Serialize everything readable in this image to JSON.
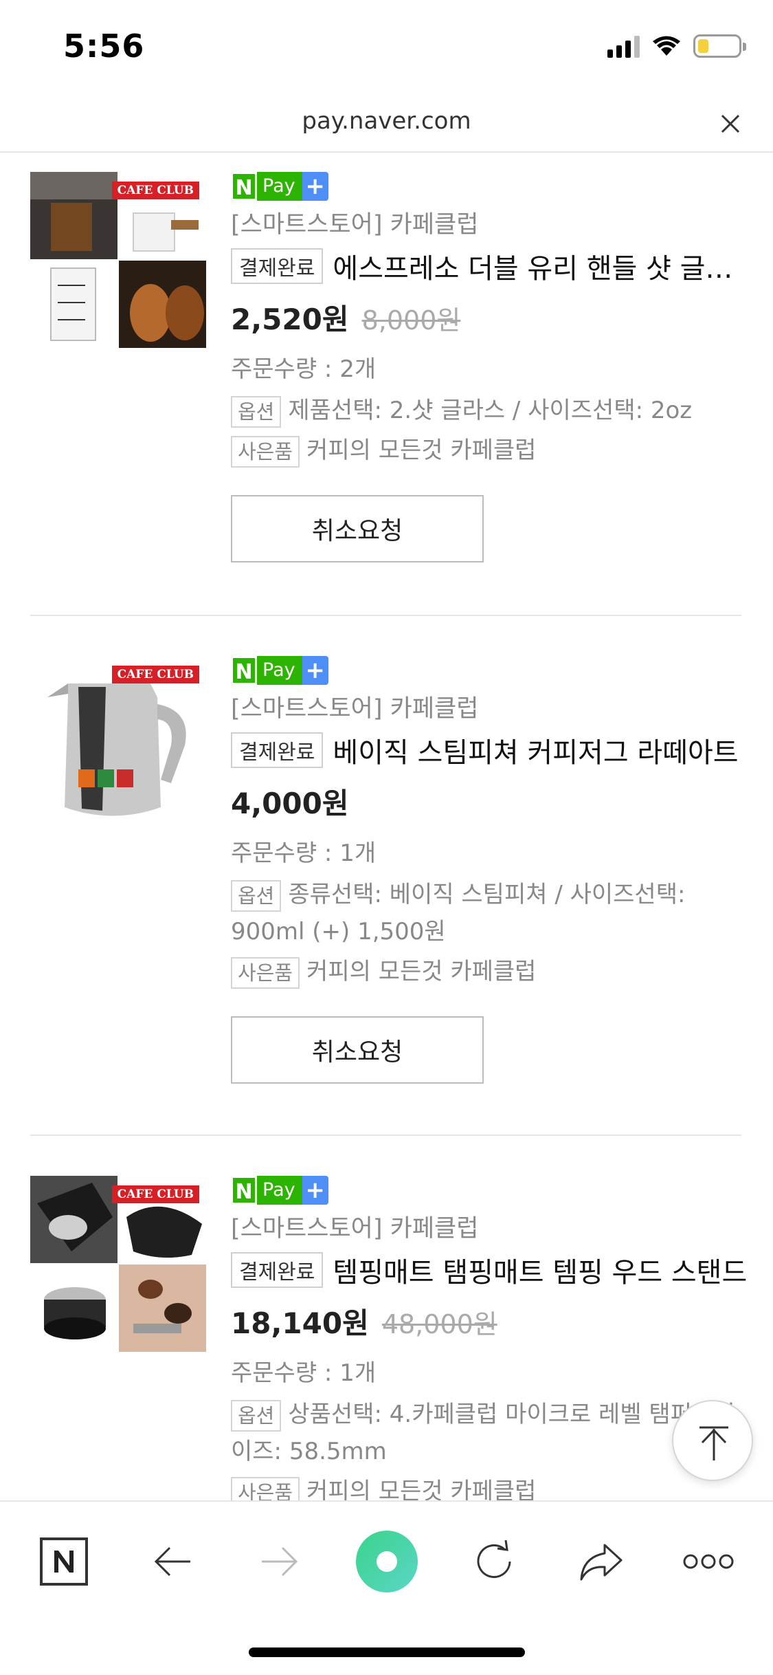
{
  "status": {
    "time": "5:56"
  },
  "browser": {
    "url": "pay.naver.com"
  },
  "npay_badge": {
    "n": "N",
    "pay": "Pay",
    "plus": "+"
  },
  "orders": [
    {
      "brand_badge": "CAFE CLUB",
      "seller": "[스마트스토어] 카페클럽",
      "status": "결제완료",
      "title": "에스프레소 더블 유리 핸들 샷 글라스",
      "price": "2,520원",
      "original_price": "8,000원",
      "quantity": "주문수량 : 2개",
      "option_tag": "옵션",
      "option": "제품선택: 2.샷 글라스 / 사이즈선택: 2oz",
      "gift_tag": "사은품",
      "gift": "커피의 모든것 카페클럽",
      "cancel_label": "취소요청"
    },
    {
      "brand_badge": "CAFE CLUB",
      "seller": "[스마트스토어] 카페클럽",
      "status": "결제완료",
      "title": "베이직 스팀피쳐 커피저그 라떼아트",
      "price": "4,000원",
      "original_price": "",
      "quantity": "주문수량 : 1개",
      "option_tag": "옵션",
      "option": "종류선택: 베이직 스팀피쳐 / 사이즈선택: 900ml (+) 1,500원",
      "gift_tag": "사은품",
      "gift": "커피의 모든것 카페클럽",
      "cancel_label": "취소요청"
    },
    {
      "brand_badge": "CAFE CLUB",
      "seller": "[스마트스토어] 카페클럽",
      "status": "결제완료",
      "title": "템핑매트 탬핑매트 템핑 우드 스탠드",
      "price": "18,140원",
      "original_price": "48,000원",
      "quantity": "주문수량 : 1개",
      "option_tag": "옵션",
      "option": "상품선택: 4.카페클럽 마이크로 레벨 탬퍼 / 사이즈: 58.5mm",
      "gift_tag": "사은품",
      "gift": "커피의 모든것 카페클럽"
    }
  ],
  "toolbar": {
    "icons": [
      "naver-home-icon",
      "back-arrow-icon",
      "forward-arrow-icon",
      "green-dot-icon",
      "reload-icon",
      "share-icon",
      "more-icon"
    ]
  },
  "colors": {
    "npay_green": "#2db400",
    "npay_blue": "#4d8ef7",
    "badge_red": "#d71f26",
    "divider": "#e6e6e6"
  }
}
